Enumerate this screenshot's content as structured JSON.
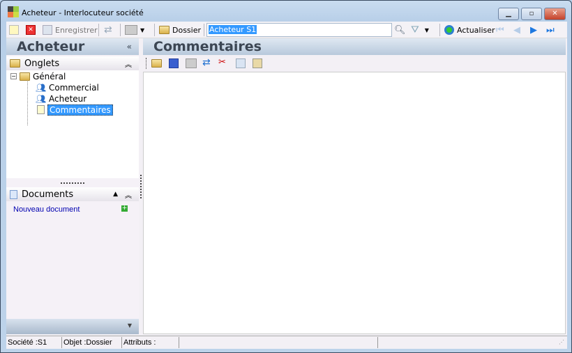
{
  "window": {
    "title": "Acheteur -  Interlocuteur société",
    "minimize": "▁",
    "maximize": "▫",
    "close": "✕"
  },
  "toolbar": {
    "save_label": "Enregistrer",
    "dossier_label": "Dossier",
    "search_value": "Acheteur S1",
    "refresh_label": "Actualiser"
  },
  "left_panel": {
    "title": "Acheteur",
    "collapse": "«",
    "onglets": {
      "label": "Onglets"
    },
    "tree": [
      {
        "label": "Général"
      },
      {
        "label": "Commercial"
      },
      {
        "label": "Acheteur"
      },
      {
        "label": "Commentaires"
      }
    ],
    "documents": {
      "label": "Documents",
      "new_document": "Nouveau document"
    }
  },
  "right_panel": {
    "title": "Commentaires"
  },
  "status": {
    "societe": "Société :S1",
    "objet": "Objet :Dossier",
    "attributs": "Attributs :"
  },
  "colors": {
    "accent": "#3399ff",
    "link": "#0000b0"
  }
}
